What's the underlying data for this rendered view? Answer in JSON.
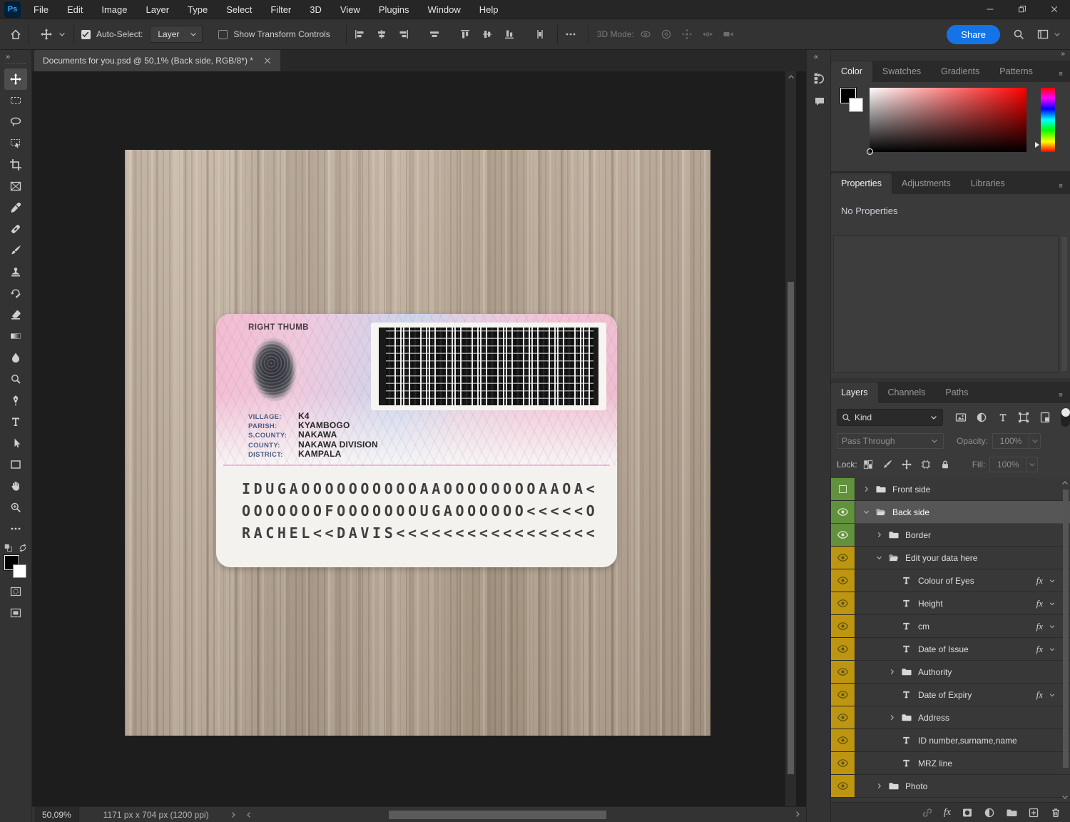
{
  "window": {
    "title_tab": "Documents for you.psd @ 50,1% (Back side, RGB/8*) *"
  },
  "menu_bar": {
    "items": [
      "File",
      "Edit",
      "Image",
      "Layer",
      "Type",
      "Select",
      "Filter",
      "3D",
      "View",
      "Plugins",
      "Window",
      "Help"
    ]
  },
  "options_bar": {
    "auto_select_label": "Auto-Select:",
    "target_value": "Layer",
    "show_transform_label": "Show Transform Controls",
    "threed_mode_label": "3D Mode:",
    "share_label": "Share"
  },
  "tools": [
    {
      "name": "move-tool",
      "icon": "move",
      "selected": true
    },
    {
      "name": "rectangular-marquee-tool",
      "icon": "marquee",
      "selected": false
    },
    {
      "name": "lasso-tool",
      "icon": "lasso",
      "selected": false
    },
    {
      "name": "object-selection-tool",
      "icon": "objselect",
      "selected": false
    },
    {
      "name": "crop-tool",
      "icon": "crop",
      "selected": false
    },
    {
      "name": "frame-tool",
      "icon": "frame",
      "selected": false
    },
    {
      "name": "eyedropper-tool",
      "icon": "eyedropper",
      "selected": false
    },
    {
      "name": "spot-healing-brush-tool",
      "icon": "healing",
      "selected": false
    },
    {
      "name": "brush-tool",
      "icon": "brush",
      "selected": false
    },
    {
      "name": "clone-stamp-tool",
      "icon": "stamp",
      "selected": false
    },
    {
      "name": "history-brush-tool",
      "icon": "historybrush",
      "selected": false
    },
    {
      "name": "eraser-tool",
      "icon": "eraser",
      "selected": false
    },
    {
      "name": "gradient-tool",
      "icon": "gradient",
      "selected": false
    },
    {
      "name": "blur-tool",
      "icon": "blur",
      "selected": false
    },
    {
      "name": "dodge-tool",
      "icon": "dodge",
      "selected": false
    },
    {
      "name": "pen-tool",
      "icon": "pen",
      "selected": false
    },
    {
      "name": "type-tool",
      "icon": "type",
      "selected": false
    },
    {
      "name": "path-selection-tool",
      "icon": "pathselect",
      "selected": false
    },
    {
      "name": "rectangle-tool",
      "icon": "rectshape",
      "selected": false
    },
    {
      "name": "hand-tool",
      "icon": "hand",
      "selected": false
    },
    {
      "name": "zoom-tool",
      "icon": "zoom",
      "selected": false
    },
    {
      "name": "edit-toolbar-button",
      "icon": "ellipsis",
      "selected": false
    }
  ],
  "document": {
    "zoom_status": "50,09%",
    "dimensions_status": "1171 px x 704 px (1200 ppi)"
  },
  "card": {
    "thumb_label": "RIGHT THUMB",
    "fields": [
      {
        "label": "VILLAGE:",
        "value": "K4"
      },
      {
        "label": "PARISH:",
        "value": "KYAMBOGO"
      },
      {
        "label": "S.COUNTY:",
        "value": "NAKAWA"
      },
      {
        "label": "COUNTY:",
        "value": "NAKAWA DIVISION"
      },
      {
        "label": "DISTRICT:",
        "value": "KAMPALA"
      }
    ],
    "mrz_lines": [
      "IDUGAOOOOOOOOOOAAOOOOOOOOAAOA<",
      "OOOOOOOFOOOOOOOUGAOOOOOO<<<<<O",
      "RACHEL<<DAVIS<<<<<<<<<<<<<<<<<"
    ]
  },
  "color_panel": {
    "tabs": [
      "Color",
      "Swatches",
      "Gradients",
      "Patterns"
    ],
    "active_tab": "Color"
  },
  "properties_panel": {
    "tabs": [
      "Properties",
      "Adjustments",
      "Libraries"
    ],
    "active_tab": "Properties",
    "empty_message": "No Properties"
  },
  "layers_panel": {
    "tabs": [
      "Layers",
      "Channels",
      "Paths"
    ],
    "active_tab": "Layers",
    "filter_label": "Kind",
    "blend_mode": "Pass Through",
    "opacity_label": "Opacity:",
    "opacity_value": "100%",
    "lock_label": "Lock:",
    "fill_label": "Fill:",
    "fill_value": "100%",
    "fx_badge": "fx",
    "rows": [
      {
        "label": "Front side",
        "type": "group",
        "indent": 0,
        "eye": false,
        "color": "green",
        "expanded": false,
        "selected": false,
        "fx": false
      },
      {
        "label": "Back side",
        "type": "group",
        "indent": 0,
        "eye": true,
        "color": "green",
        "expanded": true,
        "selected": true,
        "fx": false
      },
      {
        "label": "Border",
        "type": "group",
        "indent": 1,
        "eye": true,
        "color": "green",
        "expanded": false,
        "selected": false,
        "fx": false
      },
      {
        "label": "Edit your data here",
        "type": "group",
        "indent": 1,
        "eye": true,
        "color": "yellow",
        "expanded": true,
        "selected": false,
        "fx": false
      },
      {
        "label": "Colour of Eyes",
        "type": "text",
        "indent": 2,
        "eye": true,
        "color": "yellow",
        "expanded": false,
        "selected": false,
        "fx": true
      },
      {
        "label": "Height",
        "type": "text",
        "indent": 2,
        "eye": true,
        "color": "yellow",
        "expanded": false,
        "selected": false,
        "fx": true
      },
      {
        "label": "cm",
        "type": "text",
        "indent": 2,
        "eye": true,
        "color": "yellow",
        "expanded": false,
        "selected": false,
        "fx": true
      },
      {
        "label": "Date of Issue",
        "type": "text",
        "indent": 2,
        "eye": true,
        "color": "yellow",
        "expanded": false,
        "selected": false,
        "fx": true
      },
      {
        "label": "Authority",
        "type": "group",
        "indent": 2,
        "eye": true,
        "color": "yellow",
        "expanded": false,
        "selected": false,
        "fx": false
      },
      {
        "label": "Date of Expiry",
        "type": "text",
        "indent": 2,
        "eye": true,
        "color": "yellow",
        "expanded": false,
        "selected": false,
        "fx": true
      },
      {
        "label": "Address",
        "type": "group",
        "indent": 2,
        "eye": true,
        "color": "yellow",
        "expanded": false,
        "selected": false,
        "fx": false
      },
      {
        "label": "ID number,surname,name",
        "type": "text",
        "indent": 2,
        "eye": true,
        "color": "yellow",
        "expanded": false,
        "selected": false,
        "fx": false
      },
      {
        "label": "MRZ line",
        "type": "text",
        "indent": 2,
        "eye": true,
        "color": "yellow",
        "expanded": false,
        "selected": false,
        "fx": false
      },
      {
        "label": "Photo",
        "type": "group",
        "indent": 1,
        "eye": true,
        "color": "yellow",
        "expanded": false,
        "selected": false,
        "fx": false
      }
    ]
  },
  "colors": {
    "accent_blue": "#1473e6",
    "layer_label_green": "#61913d",
    "layer_label_yellow": "#bd9510"
  }
}
